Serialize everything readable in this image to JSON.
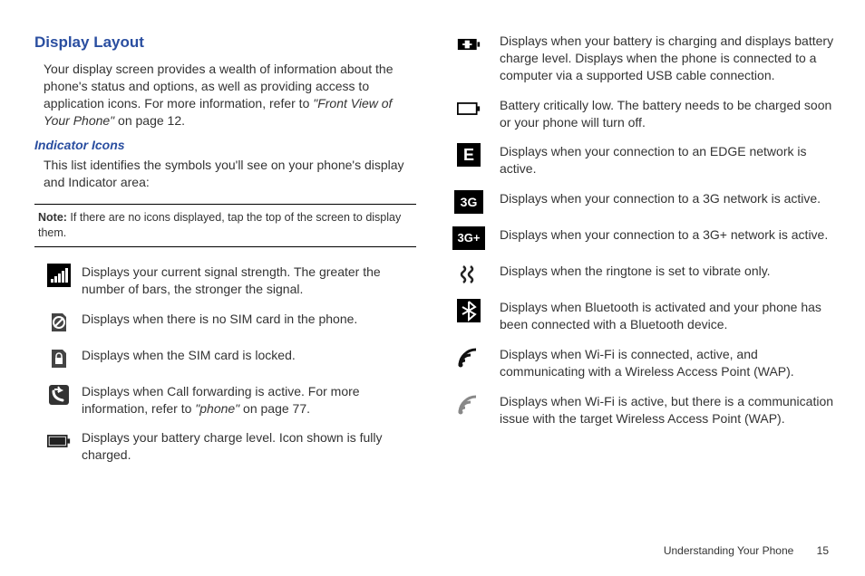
{
  "heading": "Display Layout",
  "intro_a": "Your display screen provides a wealth of information about the phone's status and options, as well as providing access to application icons. For more information, refer to ",
  "intro_ref": "\"Front View of Your Phone\"",
  "intro_b": "  on page 12.",
  "subheading": "Indicator Icons",
  "sub_intro": "This list identifies the symbols you'll see on your phone's display and Indicator area:",
  "note_label": "Note:",
  "note_text": " If there are no icons displayed, tap the top of the screen to display them.",
  "left_items": [
    {
      "id": "signal",
      "text_a": "Displays your current signal strength. The greater the number of bars, the stronger the signal.",
      "ref": "",
      "text_b": ""
    },
    {
      "id": "no-sim",
      "text_a": "Displays when there is no SIM card in the phone.",
      "ref": "",
      "text_b": ""
    },
    {
      "id": "sim-locked",
      "text_a": "Displays when the SIM card is locked.",
      "ref": "",
      "text_b": ""
    },
    {
      "id": "call-fwd",
      "text_a": "Displays when Call forwarding is active. For more information, refer to ",
      "ref": "\"phone\"",
      "text_b": "  on page 77."
    },
    {
      "id": "batt-full",
      "text_a": "Displays your battery charge level. Icon shown is fully charged.",
      "ref": "",
      "text_b": ""
    }
  ],
  "right_items": [
    {
      "id": "batt-charging",
      "text_a": "Displays when your battery is charging and displays battery charge level. Displays when the phone is connected to a computer via a supported USB cable connection.",
      "ref": "",
      "text_b": ""
    },
    {
      "id": "batt-low",
      "text_a": "Battery critically low. The battery needs to be charged soon or your phone will turn off.",
      "ref": "",
      "text_b": ""
    },
    {
      "id": "edge",
      "text_a": "Displays when your connection to an EDGE network is active.",
      "ref": "",
      "text_b": ""
    },
    {
      "id": "3g",
      "text_a": "Displays when your connection to a 3G network is active.",
      "ref": "",
      "text_b": ""
    },
    {
      "id": "3gplus",
      "text_a": "Displays when your connection to a 3G+ network is active.",
      "ref": "",
      "text_b": ""
    },
    {
      "id": "vibrate",
      "text_a": "Displays when the ringtone is set to vibrate only.",
      "ref": "",
      "text_b": ""
    },
    {
      "id": "bluetooth",
      "text_a": "Displays when Bluetooth is activated and your phone has been connected with a Bluetooth device.",
      "ref": "",
      "text_b": ""
    },
    {
      "id": "wifi-on",
      "text_a": "Displays when Wi-Fi is connected, active, and communicating with a Wireless Access Point (WAP).",
      "ref": "",
      "text_b": ""
    },
    {
      "id": "wifi-issue",
      "text_a": "Displays when Wi-Fi is active, but there is a communication issue with the target Wireless Access Point (WAP).",
      "ref": "",
      "text_b": ""
    }
  ],
  "footer_section": "Understanding Your Phone",
  "footer_page": "15"
}
